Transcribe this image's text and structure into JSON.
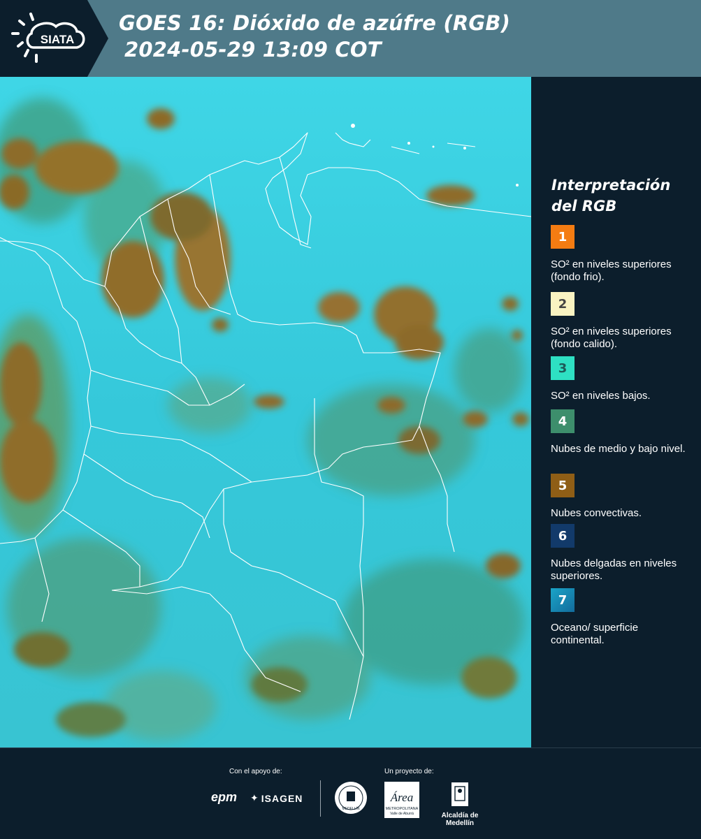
{
  "header": {
    "title_line1": "GOES 16: Dióxido de azúfre (RGB)",
    "title_line2": "2024-05-29 13:09 COT",
    "logo_text": "SIATA"
  },
  "legend": {
    "title": "Interpretación del RGB",
    "items": [
      {
        "number": "1",
        "color": "#f47c12",
        "text_color": "#ffffff",
        "label": "SO² en niveles superiores (fondo frio)."
      },
      {
        "number": "2",
        "color": "#f9f3c2",
        "text_color": "#444444",
        "label": "SO² en niveles superiores (fondo calido)."
      },
      {
        "number": "3",
        "color": "#2ee0c3",
        "text_color": "#1d5a58",
        "label": "SO² en niveles bajos."
      },
      {
        "number": "4",
        "color": "#3d8e6c",
        "text_color": "#ffffff",
        "label": "Nubes de medio y bajo nivel."
      },
      {
        "number": "5",
        "color": "#8f5e16",
        "text_color": "#ffffff",
        "label": "Nubes convectivas."
      },
      {
        "number": "6",
        "color": "#123a6a",
        "text_color": "#ffffff",
        "label": "Nubes delgadas en niveles superiores."
      },
      {
        "number": "7",
        "color": "#1a8fc2",
        "text_color": "#ffffff",
        "label": "Oceano/ superficie continental."
      }
    ]
  },
  "footer": {
    "support_label": "Con el apoyo de:",
    "project_label": "Un proyecto de:",
    "sponsor_epm": "epm",
    "sponsor_isagen": "ISAGEN",
    "sponsor_area": "Área",
    "sponsor_area_sub": "METROPOLITANA",
    "sponsor_area_sub2": "Valle de Aburrá",
    "sponsor_alcaldia": "Alcaldía de Medellín",
    "seal_text": "MEDELLÍN"
  },
  "colors": {
    "header_bg": "#4f7a89",
    "panel_bg": "#0c1e2c",
    "map_cyan": "#3ad0e0",
    "cloud_brown": "#8d6a28",
    "cloud_green": "#3b8a6a"
  }
}
